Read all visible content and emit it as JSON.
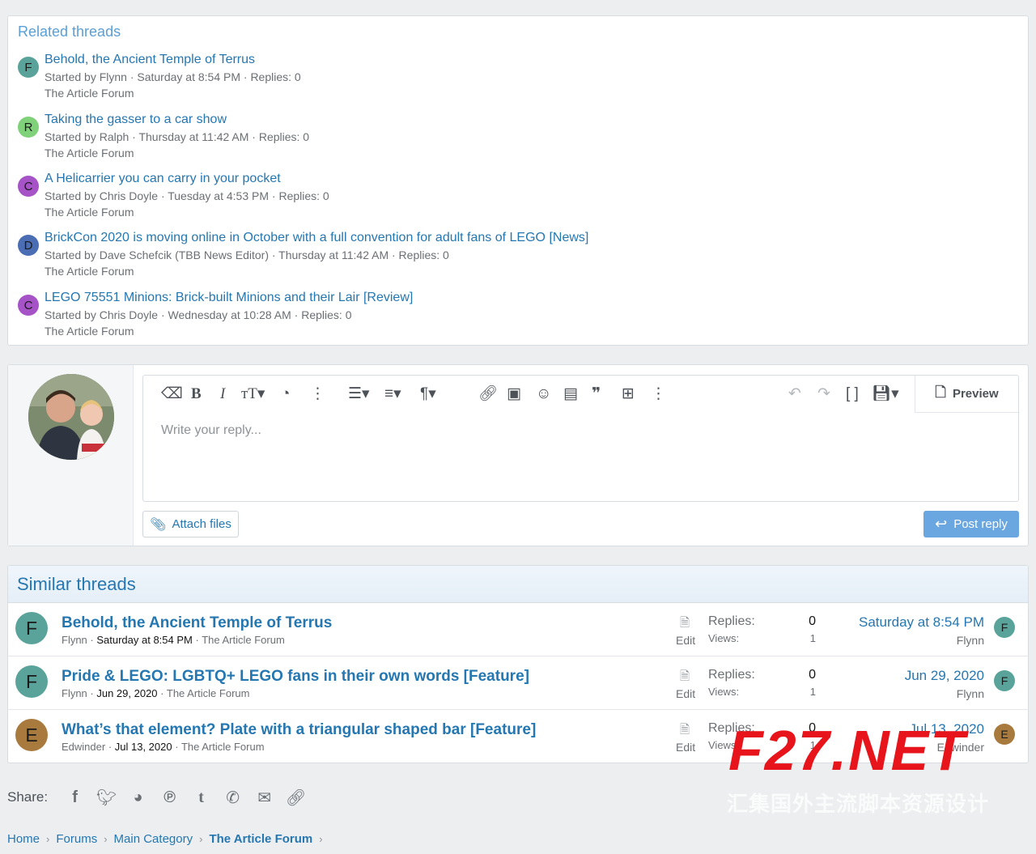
{
  "related": {
    "title": "Related threads",
    "items": [
      {
        "initial": "F",
        "color": "#5aa39a",
        "title": "Behold, the Ancient Temple of Terrus",
        "meta": "Started by Flynn · Saturday at 8:54 PM · Replies: 0",
        "forum": "The Article Forum"
      },
      {
        "initial": "R",
        "color": "#7fd17a",
        "title": "Taking the gasser to a car show",
        "meta": "Started by Ralph · Thursday at 11:42 AM · Replies: 0",
        "forum": "The Article Forum"
      },
      {
        "initial": "C",
        "color": "#a553c6",
        "title": "A Helicarrier you can carry in your pocket",
        "meta": "Started by Chris Doyle · Tuesday at 4:53 PM · Replies: 0",
        "forum": "The Article Forum"
      },
      {
        "initial": "D",
        "color": "#4a6db3",
        "title": "BrickCon 2020 is moving online in October with a full convention for adult fans of LEGO [News]",
        "meta": "Started by Dave Schefcik (TBB News Editor) · Thursday at 11:42 AM · Replies: 0",
        "forum": "The Article Forum"
      },
      {
        "initial": "C",
        "color": "#a553c6",
        "title": "LEGO 75551 Minions: Brick-built Minions and their Lair [Review]",
        "meta": "Started by Chris Doyle · Wednesday at 10:28 AM · Replies: 0",
        "forum": "The Article Forum"
      }
    ]
  },
  "reply": {
    "placeholder": "Write your reply...",
    "preview_label": "Preview",
    "attach_label": "Attach files",
    "post_label": "Post reply"
  },
  "similar": {
    "title": "Similar threads",
    "replies_label": "Replies:",
    "views_label": "Views:",
    "edit_label": "Edit",
    "rows": [
      {
        "initial": "F",
        "color": "#5aa39a",
        "title": "Behold, the Ancient Temple of Terrus",
        "author": "Flynn",
        "date": "Saturday at 8:54 PM",
        "forum": "The Article Forum",
        "replies": "0",
        "views": "1",
        "last_date": "Saturday at 8:54 PM",
        "last_user": "Flynn",
        "last_initial": "F"
      },
      {
        "initial": "F",
        "color": "#5aa39a",
        "title": "Pride & LEGO: LGBTQ+ LEGO fans in their own words [Feature]",
        "author": "Flynn",
        "date": "Jun 29, 2020",
        "forum": "The Article Forum",
        "replies": "0",
        "views": "1",
        "last_date": "Jun 29, 2020",
        "last_user": "Flynn",
        "last_initial": "F"
      },
      {
        "initial": "E",
        "color": "#a87a3e",
        "title": "What’s that element? Plate with a triangular shaped bar [Feature]",
        "author": "Edwinder",
        "date": "Jul 13, 2020",
        "forum": "The Article Forum",
        "replies": "0",
        "views": "1",
        "last_date": "Jul 13, 2020",
        "last_user": "Edwinder",
        "last_initial": "E"
      }
    ]
  },
  "share": {
    "label": "Share:"
  },
  "breadcrumbs": [
    "Home",
    "Forums",
    "Main Category",
    "The Article Forum"
  ],
  "watermark": {
    "big": "F27.NET",
    "small": "汇集国外主流脚本资源设计"
  }
}
